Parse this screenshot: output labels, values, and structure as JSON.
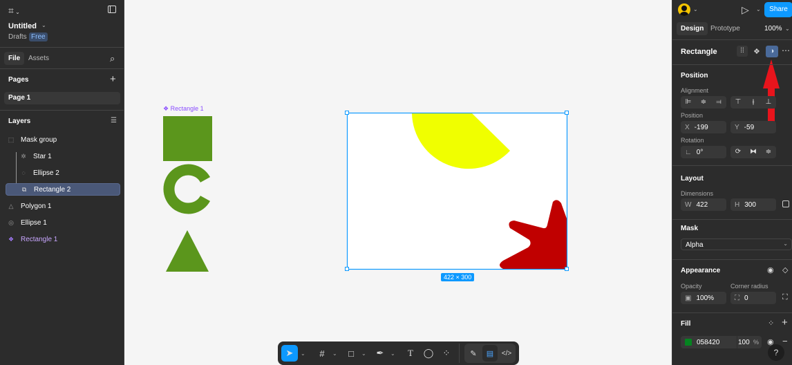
{
  "app": {
    "title": "Untitled",
    "location": "Drafts",
    "plan_badge": "Free"
  },
  "left": {
    "tabs": [
      {
        "label": "File",
        "active": true
      },
      {
        "label": "Assets",
        "active": false
      }
    ],
    "pages_title": "Pages",
    "pages": [
      "Page 1"
    ],
    "layers_title": "Layers",
    "layers": [
      {
        "label": "Mask group",
        "icon": "mask-group-icon"
      },
      {
        "label": "Star 1",
        "icon": "star-icon"
      },
      {
        "label": "Ellipse 2",
        "icon": "ellipse-icon"
      },
      {
        "label": "Rectangle 2",
        "icon": "mask-icon",
        "selected": true
      },
      {
        "label": "Polygon 1",
        "icon": "polygon-icon"
      },
      {
        "label": "Ellipse 1",
        "icon": "ellipse-icon"
      },
      {
        "label": "Rectangle 1",
        "icon": "component-icon"
      }
    ]
  },
  "canvas": {
    "component_label": "Rectangle 1",
    "size_badge": "422 × 300"
  },
  "right": {
    "share": "Share",
    "tabs": [
      {
        "label": "Design",
        "active": true
      },
      {
        "label": "Prototype",
        "active": false
      }
    ],
    "zoom": "100%",
    "selection_type": "Rectangle",
    "position": {
      "title": "Position",
      "alignment_label": "Alignment",
      "position_label": "Position",
      "x": "-199",
      "y": "-59",
      "rotation_label": "Rotation",
      "rotation": "0°"
    },
    "layout": {
      "title": "Layout",
      "dimensions_label": "Dimensions",
      "w": "422",
      "h": "300"
    },
    "mask": {
      "title": "Mask",
      "type": "Alpha"
    },
    "appearance": {
      "title": "Appearance",
      "opacity_label": "Opacity",
      "opacity": "100%",
      "radius_label": "Corner radius",
      "radius": "0"
    },
    "fill": {
      "title": "Fill",
      "hex": "058420",
      "opacity": "100",
      "unit": "%",
      "color": "#058420"
    },
    "help": "?"
  },
  "colors": {
    "accent": "#0d99ff",
    "selected_layer": "#4a5878",
    "component": "#a57cff",
    "annotation": "#e8141c"
  }
}
